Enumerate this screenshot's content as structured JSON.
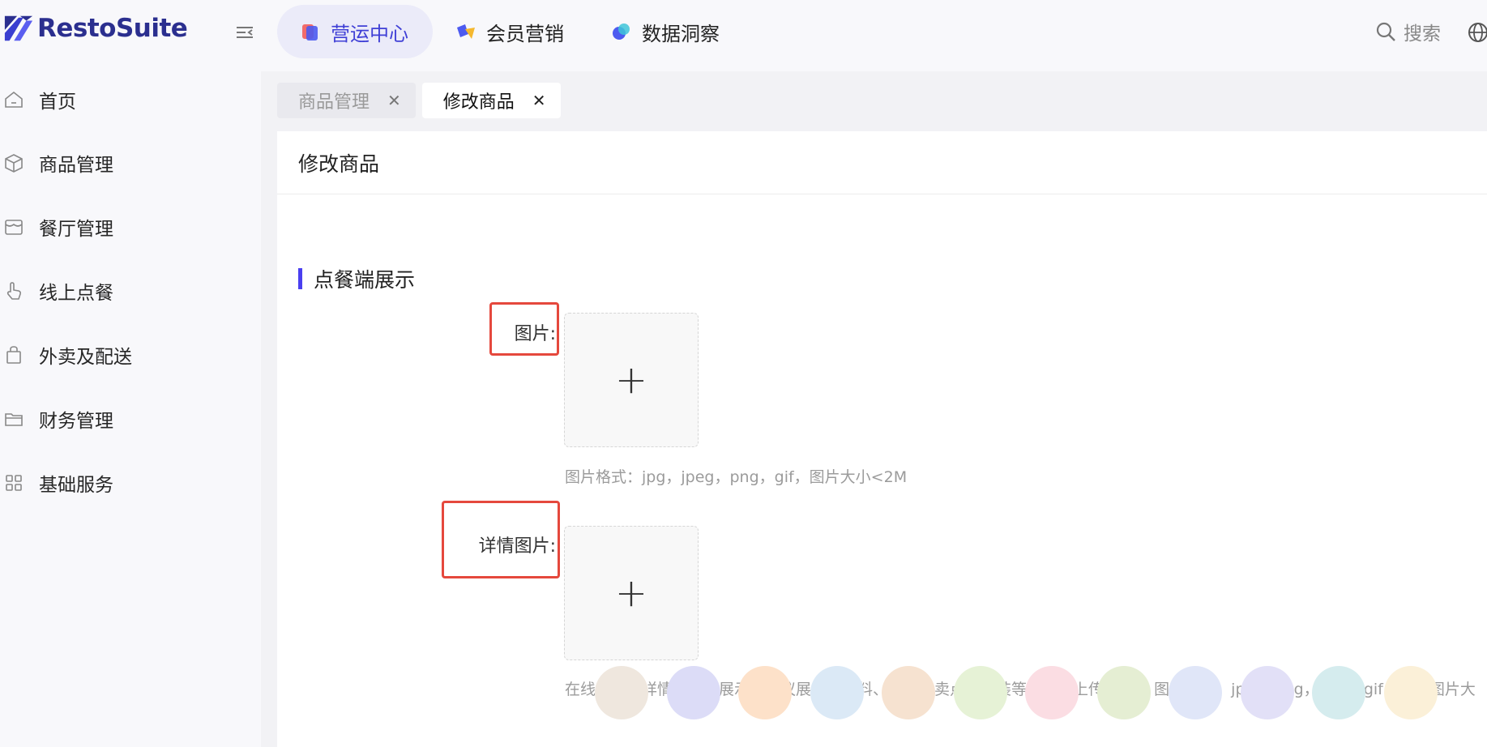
{
  "app": {
    "name": "RestoSuite"
  },
  "topnav": {
    "items": [
      {
        "label": "营运中心",
        "icon": "ops-center-icon",
        "active": true
      },
      {
        "label": "会员营销",
        "icon": "member-marketing-icon",
        "active": false
      },
      {
        "label": "数据洞察",
        "icon": "data-insight-icon",
        "active": false
      }
    ],
    "search_label": "搜索"
  },
  "sidebar": {
    "items": [
      {
        "label": "首页",
        "icon": "home-icon"
      },
      {
        "label": "商品管理",
        "icon": "box-icon"
      },
      {
        "label": "餐厅管理",
        "icon": "store-icon"
      },
      {
        "label": "线上点餐",
        "icon": "hand-tap-icon"
      },
      {
        "label": "外卖及配送",
        "icon": "bag-icon"
      },
      {
        "label": "财务管理",
        "icon": "folder-icon"
      },
      {
        "label": "基础服务",
        "icon": "grid-icon"
      }
    ]
  },
  "tabs": [
    {
      "label": "商品管理",
      "active": false
    },
    {
      "label": "修改商品",
      "active": true
    }
  ],
  "panel": {
    "title": "修改商品",
    "section_title": "点餐端展示",
    "image_field": {
      "label": "图片:",
      "hint": "图片格式：jpg，jpeg，png，gif，图片大小<2M"
    },
    "detail_image_field": {
      "label": "详情图片:",
      "hint": "在线上餐厅详情页轮播展示，建议展示原材料、特写、卖点、包装等，最多上传20张。图片格式：jpg，jpeg，png，gif，每张图片大"
    }
  },
  "colors": {
    "accent": "#4a3ff0",
    "active_nav_bg": "#ebebf9",
    "highlight": "#e5483d",
    "swatches": [
      "#efe7de",
      "#dcdcf7",
      "#fde1c9",
      "#dbe9f6",
      "#f6e2d0",
      "#e6f2d6",
      "#fbdde3",
      "#e5eed3",
      "#e0e6f8",
      "#e2e0f7",
      "#d5ecee",
      "#fbf0d8"
    ]
  }
}
